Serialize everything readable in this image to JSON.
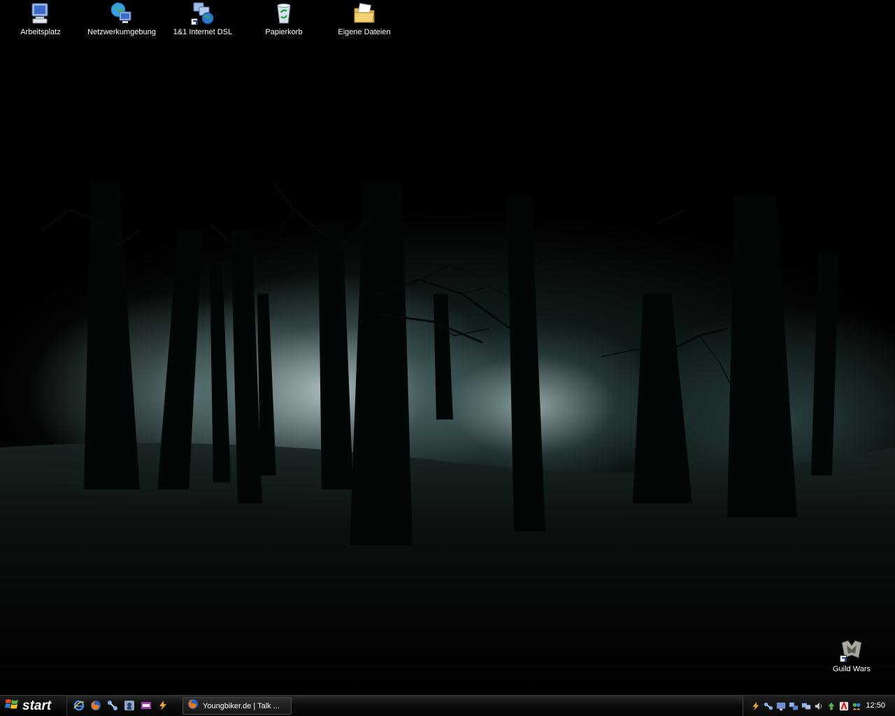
{
  "desktop": {
    "icons": [
      {
        "label": "Arbeitsplatz",
        "icon": "my-computer-icon"
      },
      {
        "label": "Netzwerkumgebung",
        "icon": "network-places-icon"
      },
      {
        "label": "1&1 Internet DSL",
        "icon": "dsl-connection-icon"
      },
      {
        "label": "Papierkorb",
        "icon": "recycle-bin-icon"
      },
      {
        "label": "Eigene Dateien",
        "icon": "my-documents-icon"
      },
      {
        "label": "Guild Wars",
        "icon": "guild-wars-icon"
      }
    ]
  },
  "taskbar": {
    "start_label": "start",
    "quick_launch": [
      "internet-explorer-icon",
      "firefox-icon",
      "network-tool-icon",
      "media-player-icon",
      "app-icon",
      "winamp-icon"
    ],
    "task_button_label": "Youngbiker.de | Talk ...",
    "tray_icons": [
      "winamp-tray-icon",
      "network-tray-icon",
      "display-tray-icon",
      "lan-connection-icon",
      "network-connection-icon",
      "sound-icon",
      "update-icon",
      "antivirus-icon",
      "messenger-icon"
    ],
    "clock": "12:50"
  },
  "colors": {
    "taskbar": "#0c0c0c",
    "text": "#ffffff"
  }
}
